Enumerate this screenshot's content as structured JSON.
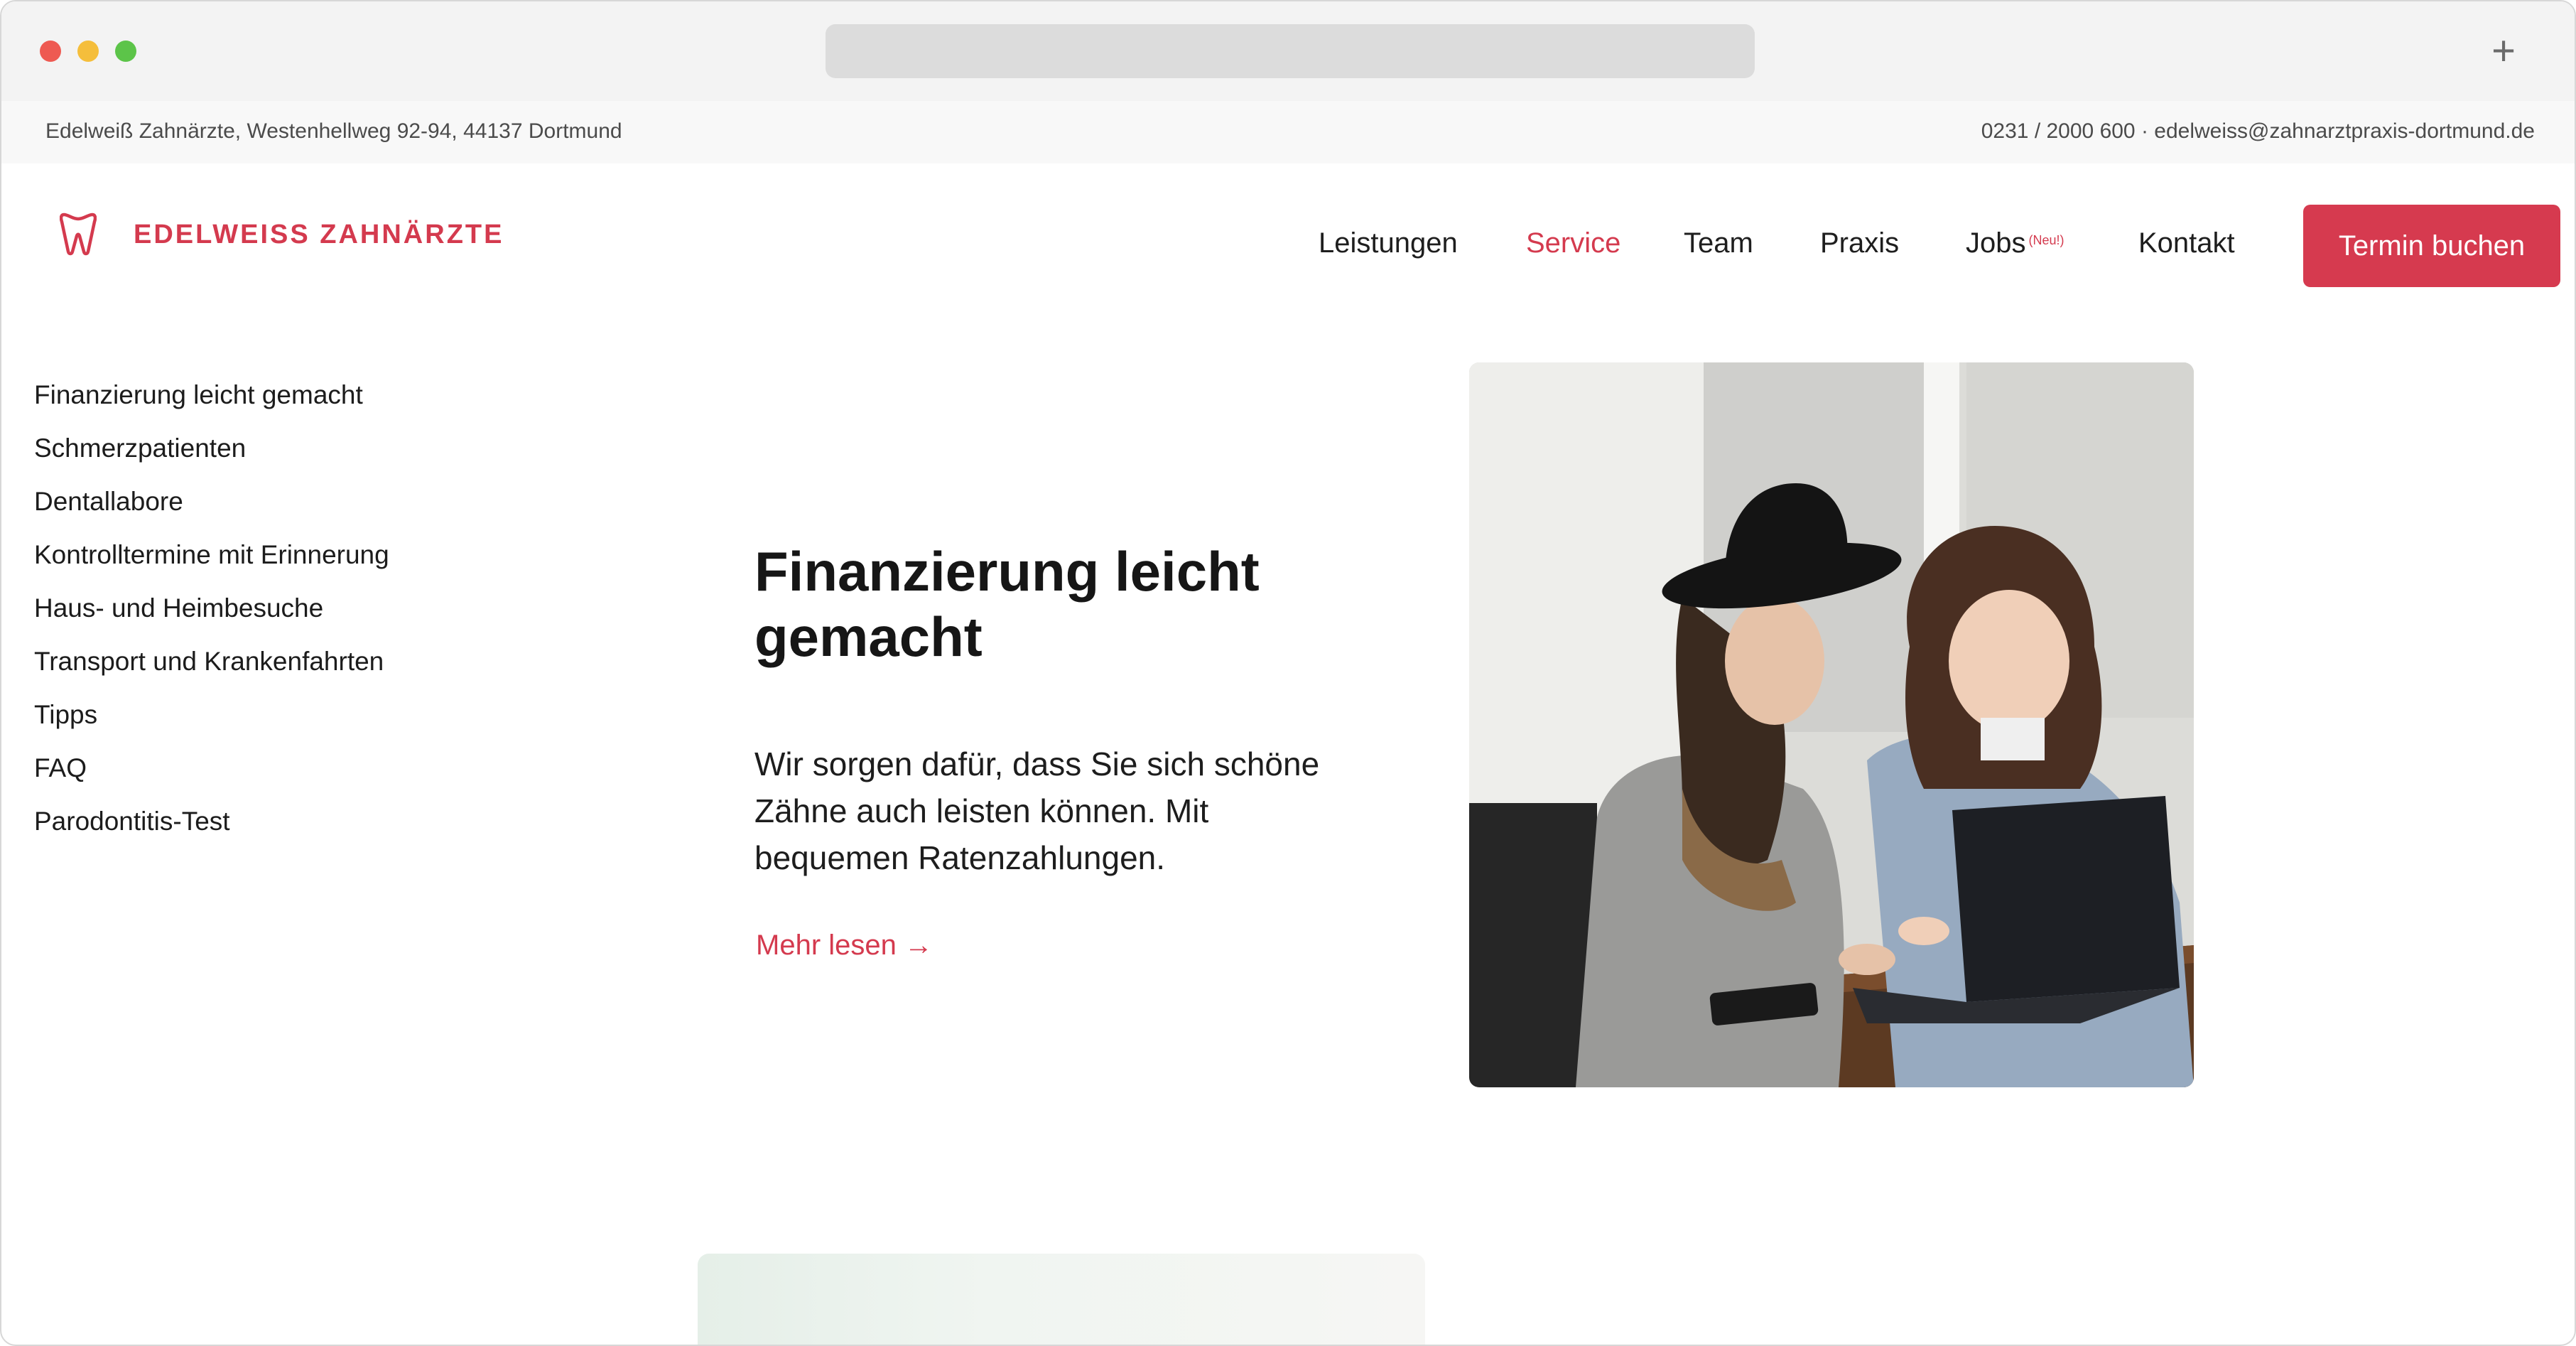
{
  "browser": {
    "new_tab_symbol": "+"
  },
  "infobar": {
    "address": "Edelweiß Zahnärzte, Westenhellweg 92-94, 44137 Dortmund",
    "contact": "0231 / 2000 600 · edelweiss@zahnarztpraxis-dortmund.de"
  },
  "header": {
    "brand": "EDELWEISS ZAHNÄRZTE",
    "logo_icon": "tooth-icon",
    "nav": [
      {
        "label": "Leistungen"
      },
      {
        "label": "Service"
      },
      {
        "label": "Team"
      },
      {
        "label": "Praxis"
      },
      {
        "label": "Jobs",
        "badge": "(Neu!)"
      },
      {
        "label": "Kontakt"
      }
    ],
    "active_nav": "Service",
    "cta": "Termin buchen"
  },
  "sidebar": {
    "items": [
      "Finanzierung leicht gemacht",
      "Schmerzpatienten",
      "Dentallabore",
      "Kontrolltermine mit Erinnerung",
      "Haus- und Heimbesuche",
      "Transport und Krankenfahrten",
      "Tipps",
      "FAQ",
      "Parodontitis-Test"
    ]
  },
  "hero": {
    "title": "Finanzierung leicht gemacht",
    "text": "Wir sorgen dafür, dass Sie sich schöne Zähne auch leisten können. Mit bequemen Ratenzahlungen.",
    "link": "Mehr lesen →"
  },
  "colors": {
    "accent": "#d63a4f",
    "text": "#1b1b1b"
  }
}
